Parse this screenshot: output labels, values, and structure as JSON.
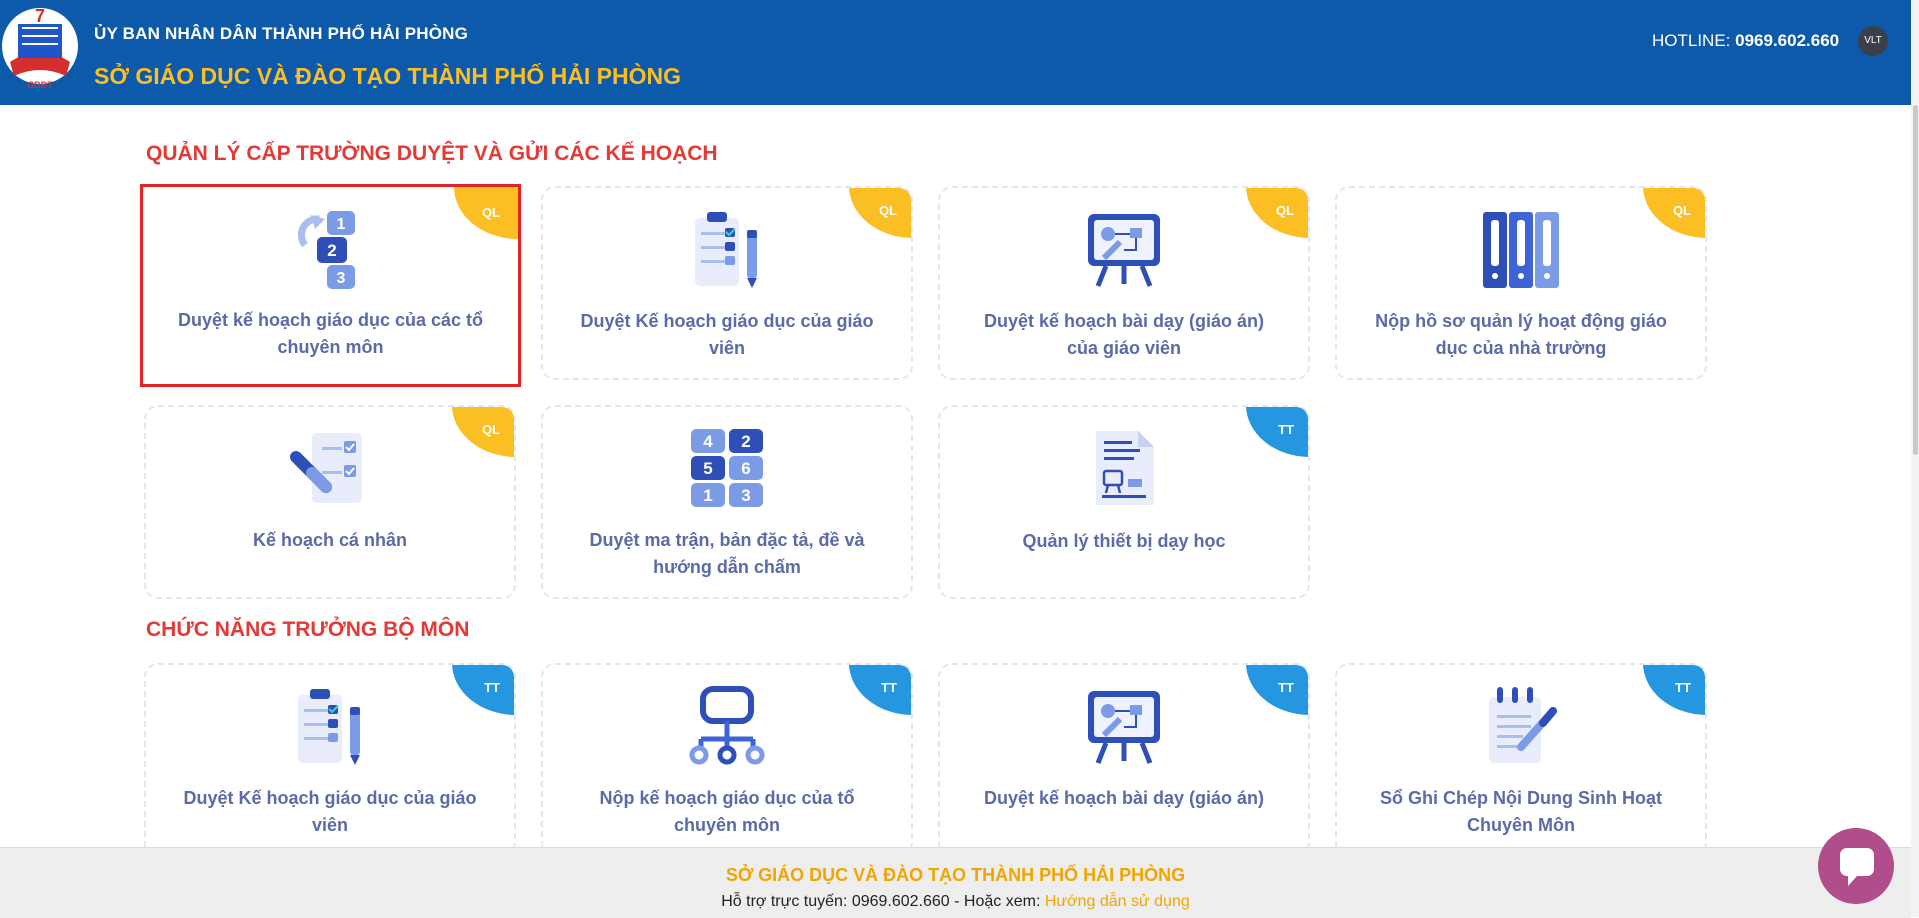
{
  "header": {
    "org_parent": "ỦY BAN NHÂN DÂN THÀNH PHỐ HẢI PHÒNG",
    "org_name": "SỞ GIÁO DỤC VÀ ĐÀO TẠO THÀNH PHỐ HẢI PHÒNG",
    "hotline_label": "HOTLINE:",
    "hotline_number": "0969.602.660",
    "avatar_initials": "VLT"
  },
  "sections": [
    {
      "title": "QUẢN LÝ CẤP TRƯỜNG DUYỆT VÀ GỬI CÁC KẾ HOẠCH",
      "cards": [
        {
          "label": "Duyệt kế hoạch giáo dục của các tổ chuyên môn",
          "badge": "QL",
          "icon": "numbered-list-icon",
          "selected": true
        },
        {
          "label": "Duyệt Kế hoạch giáo dục của giáo viên",
          "badge": "QL",
          "icon": "clipboard-checklist-icon"
        },
        {
          "label": "Duyệt kế hoạch bài dạy (giáo án) của giáo viên",
          "badge": "QL",
          "icon": "presentation-board-icon"
        },
        {
          "label": "Nộp hồ sơ quản lý hoạt động giáo dục của nhà trường",
          "badge": "QL",
          "icon": "binders-icon"
        },
        {
          "label": "Kế hoạch cá nhân",
          "badge": "QL",
          "icon": "personal-plan-icon"
        },
        {
          "label": "Duyệt ma trận, bản đặc tả, đề và hướng dẫn chấm",
          "badge": "",
          "icon": "number-grid-icon"
        },
        {
          "label": "Quản lý thiết bị dạy học",
          "badge": "TT",
          "icon": "equipment-document-icon"
        }
      ]
    },
    {
      "title": "CHỨC NĂNG TRƯỞNG BỘ MÔN",
      "cards": [
        {
          "label": "Duyệt Kế hoạch giáo dục của giáo viên",
          "badge": "TT",
          "icon": "clipboard-checklist-icon"
        },
        {
          "label": "Nộp kế hoạch giáo dục của tổ chuyên môn",
          "badge": "TT",
          "icon": "org-chart-icon"
        },
        {
          "label": "Duyệt kế hoạch bài dạy (giáo án)",
          "badge": "TT",
          "icon": "presentation-board-icon"
        },
        {
          "label": "Sổ Ghi Chép Nội Dung Sinh Hoạt Chuyên Môn",
          "badge": "TT",
          "icon": "notepad-pen-icon"
        }
      ]
    }
  ],
  "footer": {
    "title": "SỞ GIÁO DỤC VÀ ĐÀO TẠO THÀNH PHỐ HẢI PHÒNG",
    "support_text": "Hỗ trợ trực tuyến: 0969.602.660 - Hoặc xem:",
    "guide_link": "Hướng dẫn sử dụng"
  },
  "colors": {
    "header_bg": "#0d5aab",
    "badge_ql": "#fbbf24",
    "badge_tt": "#2596e0",
    "section_title": "#e53935",
    "card_text": "#5b6aa8"
  }
}
